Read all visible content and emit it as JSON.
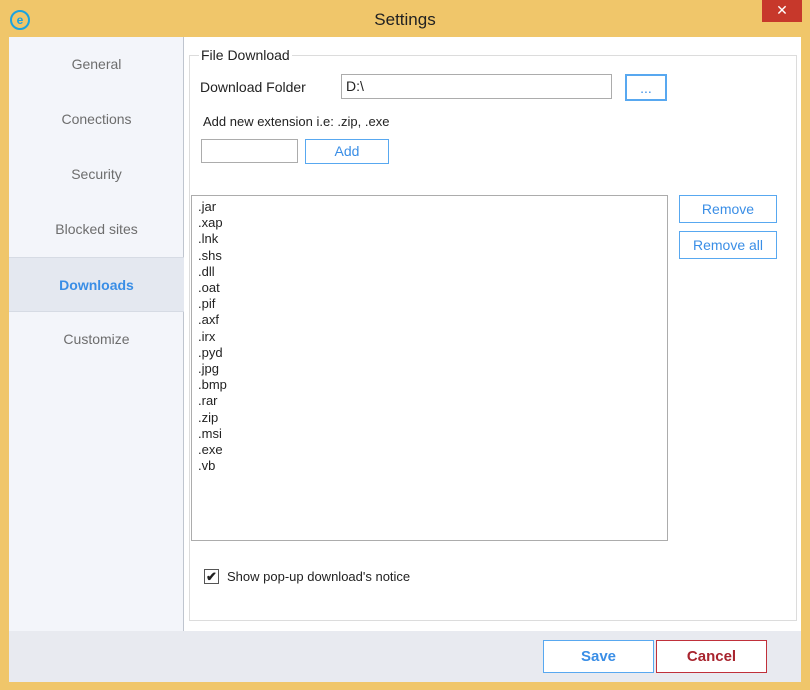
{
  "window": {
    "title": "Settings",
    "close_icon": "close-icon"
  },
  "sidebar": {
    "items": [
      {
        "label": "General"
      },
      {
        "label": "Conections"
      },
      {
        "label": "Security"
      },
      {
        "label": "Blocked sites"
      },
      {
        "label": "Downloads",
        "active": true
      },
      {
        "label": "Customize"
      }
    ]
  },
  "file_download": {
    "group_label": "File Download",
    "folder_label": "Download Folder",
    "folder_value": "D:\\",
    "browse_label": "...",
    "extension_hint": "Add new extension i.e: .zip, .exe",
    "extension_value": "",
    "add_label": "Add",
    "extensions": [
      ".jar",
      ".xap",
      ".lnk",
      ".shs",
      ".dll",
      ".oat",
      ".pif",
      ".axf",
      ".irx",
      ".pyd",
      ".jpg",
      ".bmp",
      ".rar",
      ".zip",
      ".msi",
      ".exe",
      ".vb"
    ],
    "remove_label": "Remove",
    "remove_all_label": "Remove all",
    "popup_notice_label": "Show pop-up download's notice",
    "popup_notice_checked": true
  },
  "footer": {
    "save_label": "Save",
    "cancel_label": "Cancel"
  },
  "colors": {
    "frame": "#f0c66a",
    "accent": "#3a8ee6",
    "cancel": "#c0303a"
  }
}
